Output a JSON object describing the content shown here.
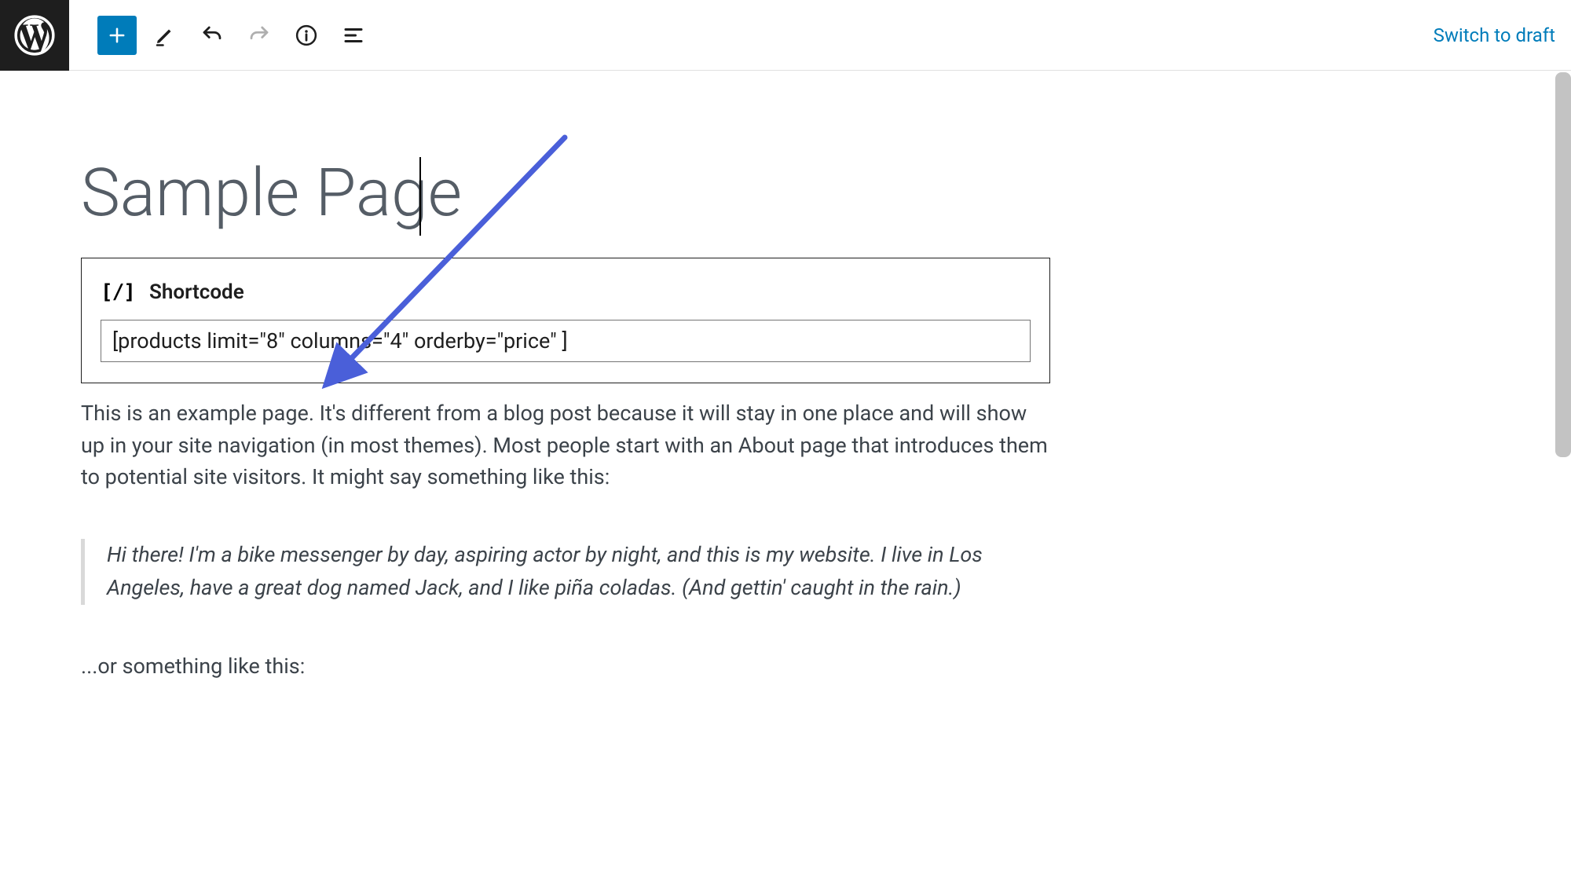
{
  "header": {
    "switch_to_draft_label": "Switch to draft"
  },
  "page": {
    "title": "Sample Page"
  },
  "shortcode": {
    "label": "Shortcode",
    "value": "[products limit=\"8\" columns=\"4\" orderby=\"price\" ]"
  },
  "content": {
    "intro_paragraph": "This is an example page. It's different from a blog post because it will stay in one place and will show up in your site navigation (in most themes). Most people start with an About page that introduces them to potential site visitors. It might say something like this:",
    "quote": "Hi there! I'm a bike messenger by day, aspiring actor by night, and this is my website. I live in Los Angeles, have a great dog named Jack, and I like piña coladas. (And gettin' caught in the rain.)",
    "after_quote": "...or something like this:"
  },
  "icons": {
    "add": "plus-icon",
    "edit": "pencil-icon",
    "undo": "undo-icon",
    "redo": "redo-icon",
    "info": "info-icon",
    "outline": "list-view-icon",
    "shortcode": "[/]"
  }
}
